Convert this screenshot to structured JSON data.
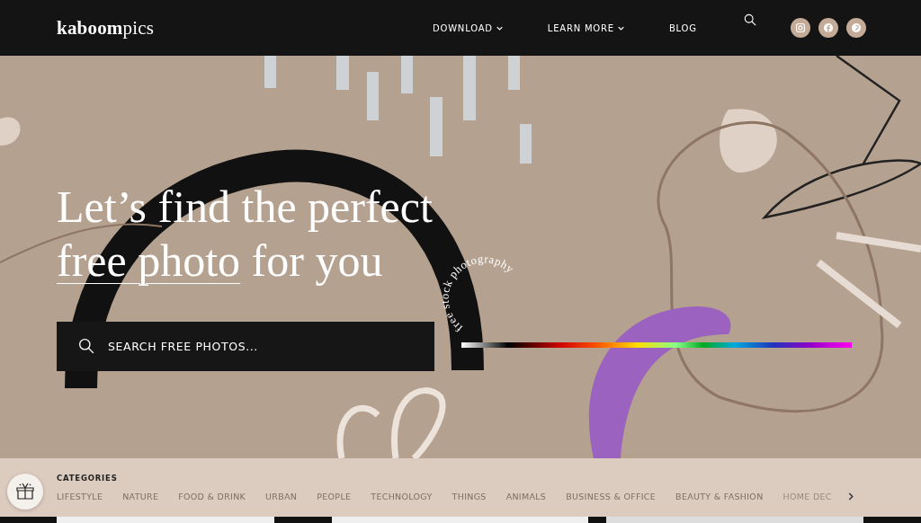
{
  "header": {
    "logo": "**kaboom**pics",
    "nav": [
      {
        "label": "DOWNLOAD",
        "dropdown": true
      },
      {
        "label": "LEARN MORE",
        "dropdown": true
      },
      {
        "label": "BLOG",
        "dropdown": false
      }
    ],
    "social": [
      {
        "kind": "instagram"
      },
      {
        "kind": "facebook"
      },
      {
        "kind": "pinterest"
      }
    ]
  },
  "hero": {
    "headline": {
      "line1": "Let’s find the perfect",
      "underlined": "free photo",
      "rest": " for you"
    },
    "search": {
      "placeholder": "SEARCH FREE PHOTOS..."
    },
    "badge": "free stock photography"
  },
  "categories": {
    "title": "CATEGORIES",
    "items": [
      "LIFESTYLE",
      "NATURE",
      "FOOD & DRINK",
      "URBAN",
      "PEOPLE",
      "TECHNOLOGY",
      "THINGS",
      "ANIMALS",
      "BUSINESS & OFFICE",
      "BEAUTY & FASHION",
      "HOME DEC"
    ]
  }
}
